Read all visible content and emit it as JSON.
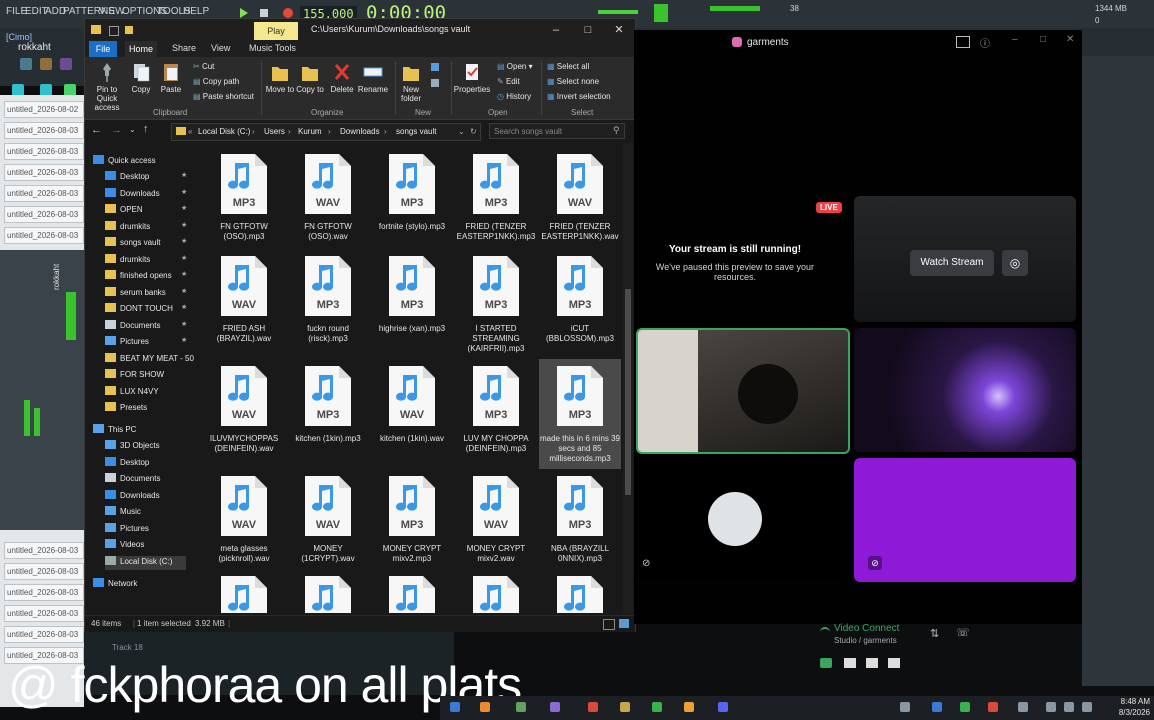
{
  "fl_studio": {
    "menu": [
      "FILE",
      "EDIT",
      "ADD",
      "PATTERNS",
      "VIEW",
      "OPTIONS",
      "TOOLS",
      "HELP"
    ],
    "time": "0:00:00",
    "bpm": "155.000",
    "cpu": "38",
    "memory": "1344 MB",
    "voices": "0",
    "user_label": "[Cimo]",
    "user_name": "rokkaht",
    "playlist_items": [
      "untitled_2026-08-02",
      "untitled_2026-08-03",
      "untitled_2026-08-03",
      "untitled_2026-08-03",
      "untitled_2026-08-03",
      "untitled_2026-08-03",
      "untitled_2026-08-03",
      "untitled_2026-08-03",
      "untitled_2026-08-03",
      "untitled_2026-08-03",
      "untitled_2026-08-03",
      "untitled_2026-08-03",
      "untitled_2026-08-03"
    ],
    "track_label": "Track 18",
    "mixer_name": "rokkaht"
  },
  "explorer": {
    "title_path": "C:\\Users\\Kurum\\Downloads\\songs vault",
    "play_tab": "Play",
    "ribbon_tabs": [
      "File",
      "Home",
      "Share",
      "View",
      "Music Tools"
    ],
    "clipboard": {
      "pin": "Pin to Quick access",
      "copy": "Copy",
      "paste": "Paste",
      "cut": "Cut",
      "copy_path": "Copy path",
      "paste_shortcut": "Paste shortcut",
      "label": "Clipboard"
    },
    "organize": {
      "move_to": "Move to",
      "copy_to": "Copy to",
      "delete": "Delete",
      "rename": "Rename",
      "label": "Organize"
    },
    "new": {
      "new_folder": "New folder",
      "label": "New"
    },
    "open": {
      "properties": "Properties",
      "open": "Open",
      "edit": "Edit",
      "history": "History",
      "label": "Open"
    },
    "select": {
      "select_all": "Select all",
      "select_none": "Select none",
      "invert": "Invert selection",
      "label": "Select"
    },
    "breadcrumb": [
      "Local Disk (C:)",
      "Users",
      "Kurum",
      "Downloads",
      "songs vault"
    ],
    "search_placeholder": "Search songs vault",
    "nav": [
      {
        "label": "Quick access",
        "icon": "star-icon"
      },
      {
        "label": "Desktop",
        "icon": "desktop-icon",
        "pin": true
      },
      {
        "label": "Downloads",
        "icon": "download-icon",
        "pin": true
      },
      {
        "label": "OPEN",
        "icon": "folder-icon",
        "pin": true
      },
      {
        "label": "drumkits",
        "icon": "folder-icon",
        "pin": true
      },
      {
        "label": "songs vault",
        "icon": "folder-icon",
        "pin": true
      },
      {
        "label": "drumkits",
        "icon": "folder-icon",
        "pin": true
      },
      {
        "label": "finished opens",
        "icon": "folder-icon",
        "pin": true
      },
      {
        "label": "serum banks",
        "icon": "folder-icon",
        "pin": true
      },
      {
        "label": "DONT TOUCH",
        "icon": "folder-icon",
        "pin": true
      },
      {
        "label": "Documents",
        "icon": "documents-icon",
        "pin": true
      },
      {
        "label": "Pictures",
        "icon": "pictures-icon",
        "pin": true
      },
      {
        "label": "BEAT MY MEAT - 50",
        "icon": "folder-icon"
      },
      {
        "label": "FOR SHOW",
        "icon": "folder-icon"
      },
      {
        "label": "LUX N4VY",
        "icon": "folder-icon"
      },
      {
        "label": "Presets",
        "icon": "folder-icon"
      },
      {
        "label": "This PC",
        "icon": "pc-icon"
      },
      {
        "label": "3D Objects",
        "icon": "cube-icon"
      },
      {
        "label": "Desktop",
        "icon": "desktop-icon"
      },
      {
        "label": "Documents",
        "icon": "documents-icon"
      },
      {
        "label": "Downloads",
        "icon": "download-icon"
      },
      {
        "label": "Music",
        "icon": "music-icon"
      },
      {
        "label": "Pictures",
        "icon": "pictures-icon"
      },
      {
        "label": "Videos",
        "icon": "videos-icon"
      },
      {
        "label": "Local Disk (C:)",
        "icon": "drive-icon"
      },
      {
        "label": "Network",
        "icon": "network-icon"
      }
    ],
    "files": [
      {
        "name": "FN GTFOTW (OSO).mp3",
        "type": "MP3"
      },
      {
        "name": "FN GTFOTW (OSO).wav",
        "type": "WAV"
      },
      {
        "name": "fortnite (stylo).mp3",
        "type": "MP3"
      },
      {
        "name": "FRIED (TENZER EASTERP1NKK).mp3",
        "type": "MP3"
      },
      {
        "name": "FRIED (TENZER EASTERP1NKK).wav",
        "type": "WAV"
      },
      {
        "name": "FRIED ASH (BRAYZIL).wav",
        "type": "WAV"
      },
      {
        "name": "fuckn round (risck).mp3",
        "type": "MP3"
      },
      {
        "name": "highrise (xan).mp3",
        "type": "MP3"
      },
      {
        "name": "I STARTED STREAMING (KAIRFRII).mp3",
        "type": "MP3"
      },
      {
        "name": "iCUT (BBLOSSOM).mp3",
        "type": "MP3"
      },
      {
        "name": "ILUVMYCHOPPAS (DEINFEIN).wav",
        "type": "WAV"
      },
      {
        "name": "kitchen (1kin).mp3",
        "type": "MP3"
      },
      {
        "name": "kitchen (1kin).wav",
        "type": "WAV"
      },
      {
        "name": "LUV MY CHOPPA (DEINFEIN).mp3",
        "type": "MP3"
      },
      {
        "name": "made this in 6 mins 39 secs and 85 milliseconds.mp3",
        "type": "MP3",
        "selected": true
      },
      {
        "name": "meta glasses (picknroll).wav",
        "type": "WAV"
      },
      {
        "name": "MONEY (1CRYPT).wav",
        "type": "WAV"
      },
      {
        "name": "MONEY CRYPT mixv2.mp3",
        "type": "MP3"
      },
      {
        "name": "MONEY CRYPT mixv2.wav",
        "type": "WAV"
      },
      {
        "name": "NBA (BRAYZILL 0NNIX).mp3",
        "type": "MP3"
      },
      {
        "name": "",
        "type": ""
      },
      {
        "name": "",
        "type": ""
      },
      {
        "name": "",
        "type": ""
      },
      {
        "name": "",
        "type": ""
      },
      {
        "name": "",
        "type": ""
      }
    ],
    "status": {
      "items": "46 items",
      "selected": "1 item selected",
      "size": "3.92 MB"
    }
  },
  "discord": {
    "server": "garments",
    "live_badge": "LIVE",
    "stream_msg_title": "Your stream is still running!",
    "stream_msg_body": "We've paused this preview to save your resources.",
    "watch_button": "Watch Stream",
    "voice_connected": "Video Connect",
    "voice_channel": "Studio / garments"
  },
  "overlay": {
    "text": "@ fckphoraa on all plats"
  },
  "taskbar": {
    "time": "8:48 AM",
    "date": "8/3/2026"
  },
  "colors": {
    "fl_green": "#b8f27a",
    "explorer_bg": "#191919",
    "discord_purple": "#8e19d6",
    "live_red": "#ed4245",
    "speaking_green": "#3ba55d"
  }
}
